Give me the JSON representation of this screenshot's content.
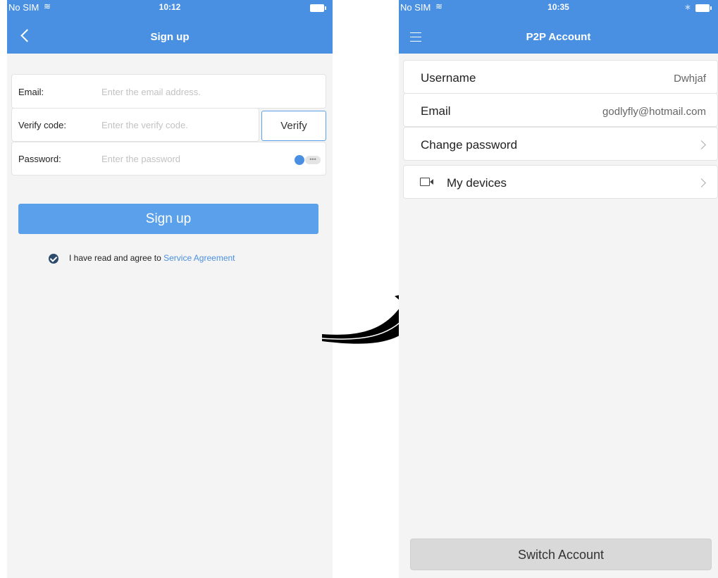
{
  "left_screen": {
    "status": {
      "carrier": "No SIM",
      "time": "10:12"
    },
    "nav": {
      "title": "Sign up"
    },
    "form": {
      "email_label": "Email:",
      "email_placeholder": "Enter the email address.",
      "verify_label": "Verify code:",
      "verify_placeholder": "Enter the verify code.",
      "verify_button": "Verify",
      "password_label": "Password:",
      "password_placeholder": "Enter the password",
      "toggle_dots": "•••"
    },
    "signup_button": "Sign up",
    "agreement": {
      "text": "I have read and agree to ",
      "link": "Service Agreement"
    }
  },
  "right_screen": {
    "status": {
      "carrier": "No SIM",
      "time": "10:35",
      "bluetooth": "∗"
    },
    "nav": {
      "title": "P2P Account"
    },
    "rows": {
      "username_label": "Username",
      "username_value": "Dwhjaf",
      "email_label": "Email",
      "email_value": "godlyfly@hotmail.com",
      "change_password_label": "Change password",
      "my_devices_label": "My devices"
    },
    "switch_button": "Switch Account"
  },
  "colors": {
    "accent": "#4a90e2",
    "background": "#f4f4f4"
  }
}
